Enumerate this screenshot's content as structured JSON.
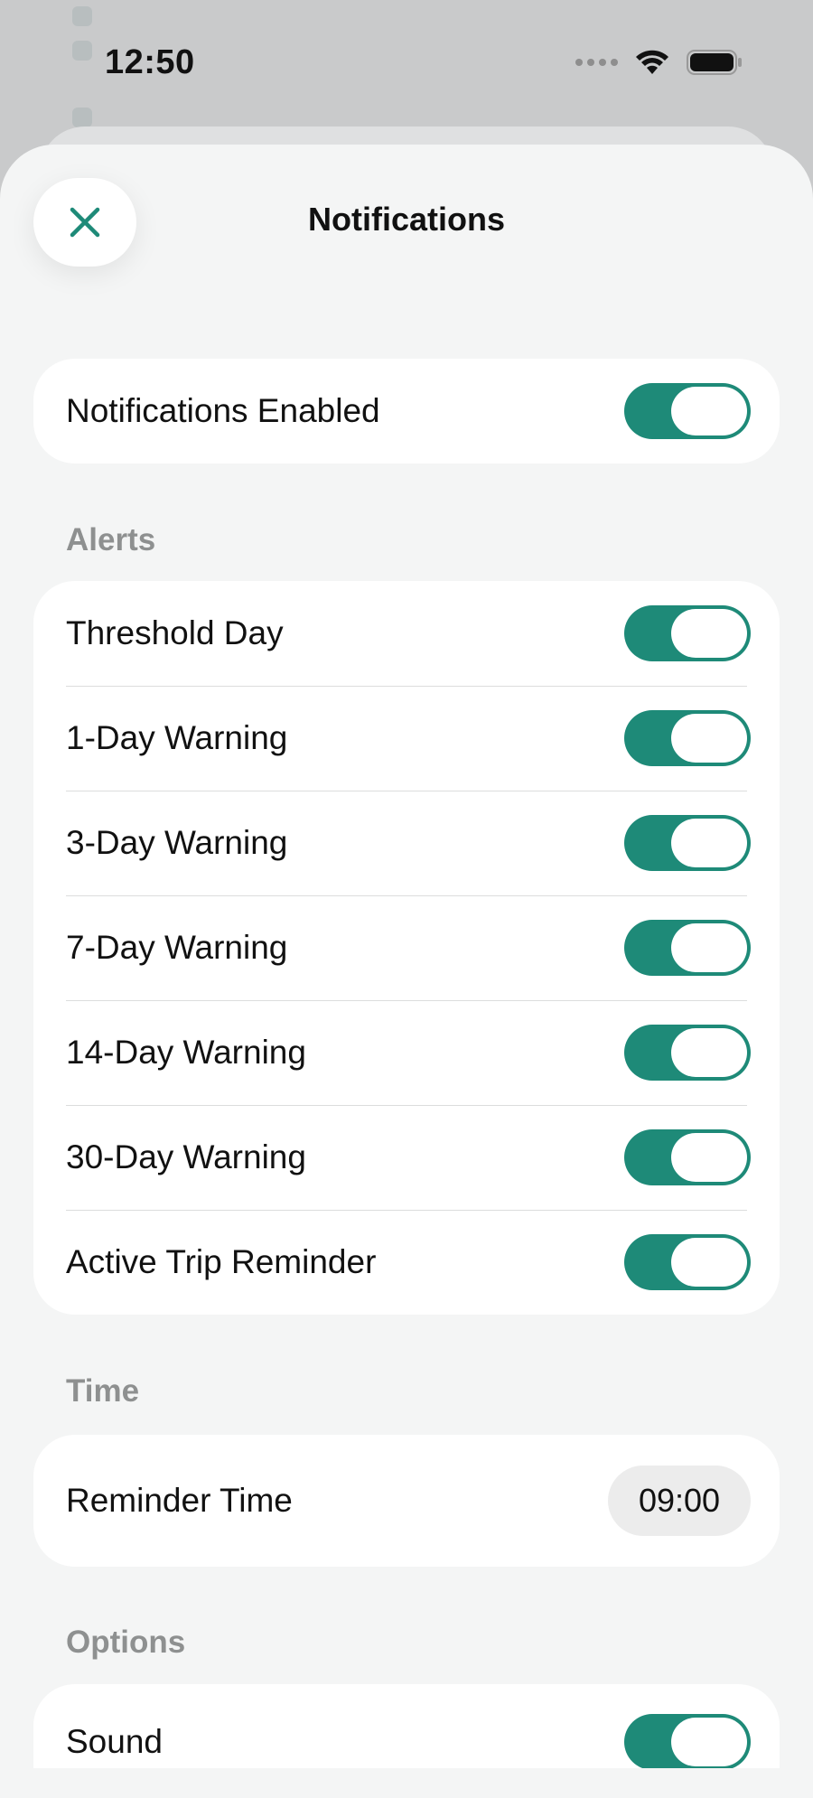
{
  "status_bar": {
    "time": "12:50"
  },
  "header": {
    "title": "Notifications",
    "close_icon": "close-icon"
  },
  "master": {
    "label": "Notifications Enabled",
    "on": true
  },
  "alerts": {
    "header": "Alerts",
    "items": [
      {
        "label": "Threshold Day",
        "on": true
      },
      {
        "label": "1-Day Warning",
        "on": true
      },
      {
        "label": "3-Day Warning",
        "on": true
      },
      {
        "label": "7-Day Warning",
        "on": true
      },
      {
        "label": "14-Day Warning",
        "on": true
      },
      {
        "label": "30-Day Warning",
        "on": true
      },
      {
        "label": "Active Trip Reminder",
        "on": true
      }
    ]
  },
  "time_section": {
    "header": "Time",
    "reminder_label": "Reminder Time",
    "reminder_value": "09:00"
  },
  "options": {
    "header": "Options",
    "items": [
      {
        "label": "Sound",
        "on": true
      }
    ]
  },
  "colors": {
    "accent": "#1e8a78",
    "sheet": "#f4f5f5",
    "card": "#ffffff",
    "section_header": "#8e9090"
  }
}
